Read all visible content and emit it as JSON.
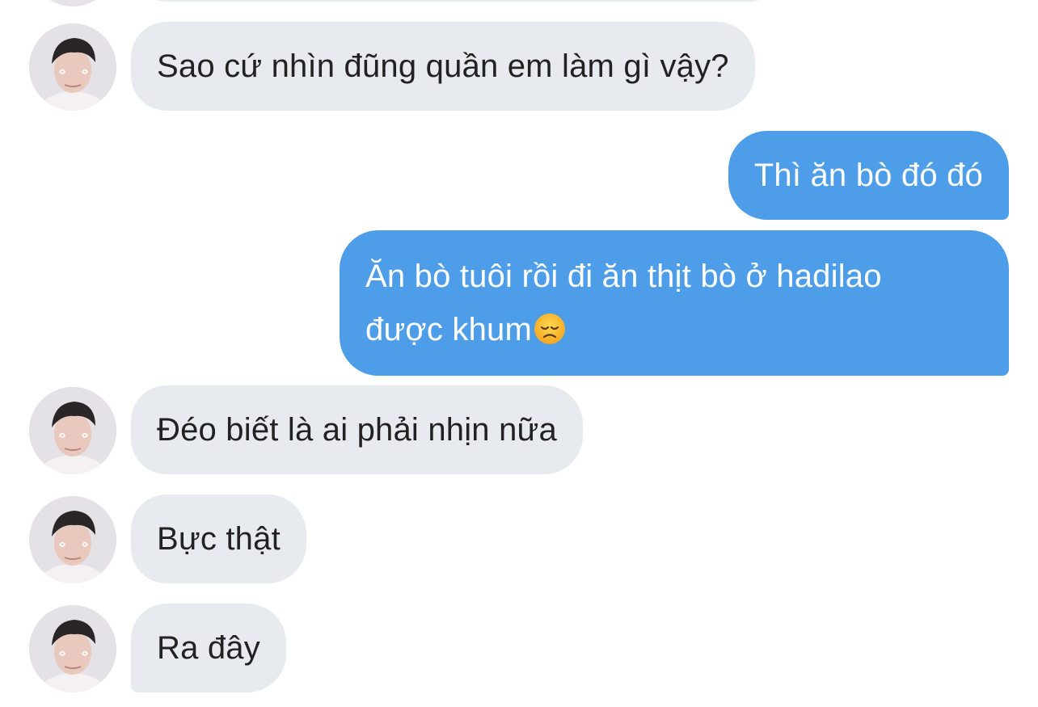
{
  "chat": {
    "messages": [
      {
        "side": "in",
        "text": ""
      },
      {
        "side": "in",
        "text": "Sao cứ nhìn đũng quần em làm gì vậy?"
      },
      {
        "side": "out",
        "text": "Thì ăn bò đó đó"
      },
      {
        "side": "out",
        "line1": "Ăn bò tuôi rồi đi ăn thịt bò ở hadilao",
        "line2": "được khum",
        "emoji": "disappointed-face-icon"
      },
      {
        "side": "in",
        "text": "Đéo biết là ai phải nhịn nữa"
      },
      {
        "side": "in",
        "text": "Bực thật"
      },
      {
        "side": "in",
        "text": "Ra đây"
      }
    ]
  },
  "colors": {
    "incoming_bubble": "#e7ebf0",
    "incoming_text": "#222222",
    "outgoing_bubble": "#4e9de9",
    "outgoing_text": "#ffffff",
    "background": "#ffffff"
  }
}
